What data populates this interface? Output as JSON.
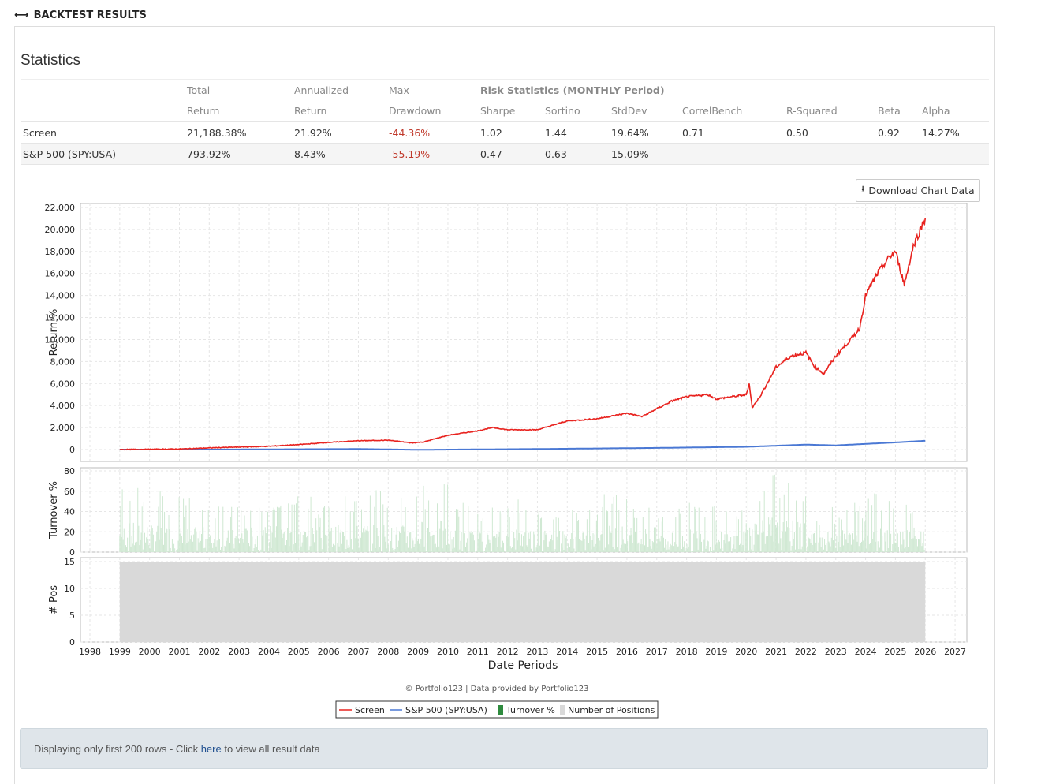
{
  "header": {
    "title": "BACKTEST RESULTS"
  },
  "stats": {
    "title": "Statistics",
    "risk_header": "Risk Statistics (MONTHLY Period)",
    "col_top": [
      "Total",
      "Annualized",
      "Max"
    ],
    "cols": [
      "Return",
      "Return",
      "Drawdown",
      "Sharpe",
      "Sortino",
      "StdDev",
      "CorrelBench",
      "R-Squared",
      "Beta",
      "Alpha"
    ],
    "rows": [
      {
        "name": "Screen",
        "values": [
          "21,188.38%",
          "21.92%",
          "-44.36%",
          "1.02",
          "1.44",
          "19.64%",
          "0.71",
          "0.50",
          "0.92",
          "14.27%"
        ]
      },
      {
        "name": "S&P 500 (SPY:USA)",
        "values": [
          "793.92%",
          "8.43%",
          "-55.19%",
          "0.47",
          "0.63",
          "15.09%",
          "-",
          "-",
          "-",
          "-"
        ]
      }
    ]
  },
  "download_label": "Download Chart Data",
  "chart_data": {
    "type": "line",
    "xlabel": "Date Periods",
    "x_ticks": [
      "1998",
      "1999",
      "2000",
      "2001",
      "2002",
      "2003",
      "2004",
      "2005",
      "2006",
      "2007",
      "2008",
      "2009",
      "2010",
      "2011",
      "2012",
      "2013",
      "2014",
      "2015",
      "2016",
      "2017",
      "2018",
      "2019",
      "2020",
      "2021",
      "2022",
      "2023",
      "2024",
      "2025",
      "2026",
      "2027"
    ],
    "panels": [
      {
        "ylabel": "Return %",
        "ylim": [
          0,
          22000
        ],
        "y_ticks": [
          "0",
          "2,000",
          "4,000",
          "6,000",
          "8,000",
          "10,000",
          "12,000",
          "14,000",
          "16,000",
          "18,000",
          "20,000",
          "22,000"
        ]
      },
      {
        "ylabel": "Turnover %",
        "ylim": [
          0,
          80
        ],
        "y_ticks": [
          "0",
          "20",
          "40",
          "60",
          "80"
        ]
      },
      {
        "ylabel": "# Pos",
        "ylim": [
          0,
          15
        ],
        "y_ticks": [
          "0",
          "5",
          "10",
          "15"
        ]
      }
    ],
    "series": [
      {
        "name": "Screen",
        "color": "#e8231f",
        "points": [
          [
            1999,
            0
          ],
          [
            2001,
            50
          ],
          [
            2002,
            150
          ],
          [
            2004,
            300
          ],
          [
            2005,
            450
          ],
          [
            2006,
            650
          ],
          [
            2007,
            800
          ],
          [
            2008,
            850
          ],
          [
            2008.8,
            600
          ],
          [
            2009.2,
            700
          ],
          [
            2010,
            1300
          ],
          [
            2011,
            1700
          ],
          [
            2011.5,
            2000
          ],
          [
            2012,
            1800
          ],
          [
            2013,
            1800
          ],
          [
            2013.5,
            2200
          ],
          [
            2014,
            2600
          ],
          [
            2015,
            2800
          ],
          [
            2016,
            3300
          ],
          [
            2016.5,
            3000
          ],
          [
            2017,
            3700
          ],
          [
            2017.5,
            4400
          ],
          [
            2018,
            4800
          ],
          [
            2018.7,
            5000
          ],
          [
            2019,
            4600
          ],
          [
            2020,
            5000
          ],
          [
            2020.1,
            6000
          ],
          [
            2020.2,
            3800
          ],
          [
            2020.5,
            5000
          ],
          [
            2021,
            7500
          ],
          [
            2021.5,
            8500
          ],
          [
            2022,
            8800
          ],
          [
            2022.3,
            7500
          ],
          [
            2022.6,
            6900
          ],
          [
            2023,
            8500
          ],
          [
            2023.5,
            10000
          ],
          [
            2023.8,
            11000
          ],
          [
            2024,
            14000
          ],
          [
            2024.4,
            16000
          ],
          [
            2024.8,
            17500
          ],
          [
            2025,
            18000
          ],
          [
            2025.3,
            15000
          ],
          [
            2025.6,
            18500
          ],
          [
            2026,
            21000
          ]
        ]
      },
      {
        "name": "S&P 500 (SPY:USA)",
        "color": "#4a78d4",
        "points": [
          [
            1999,
            0
          ],
          [
            2002,
            0
          ],
          [
            2007,
            50
          ],
          [
            2009,
            -20
          ],
          [
            2013,
            50
          ],
          [
            2017,
            150
          ],
          [
            2020,
            250
          ],
          [
            2022,
            450
          ],
          [
            2023,
            380
          ],
          [
            2025,
            650
          ],
          [
            2026,
            800
          ]
        ]
      },
      {
        "name": "Turnover %",
        "color": "#2e8b3e",
        "yearly_peak": [
          65,
          60,
          55,
          50,
          55,
          60,
          55,
          60,
          65,
          60,
          70,
          50,
          45,
          55,
          50,
          45,
          60,
          55,
          45,
          50,
          45,
          80,
          70,
          45,
          50,
          60,
          55,
          60
        ]
      },
      {
        "name": "Number of Positions",
        "color": "#d9d9d9",
        "value": 15,
        "range": [
          1999,
          2026
        ]
      }
    ],
    "credit": "© Portfolio123 | Data provided by Portfolio123"
  },
  "notice": {
    "prefix": "Displaying only first 200 rows - Click ",
    "link": "here",
    "suffix": " to view all result data"
  }
}
